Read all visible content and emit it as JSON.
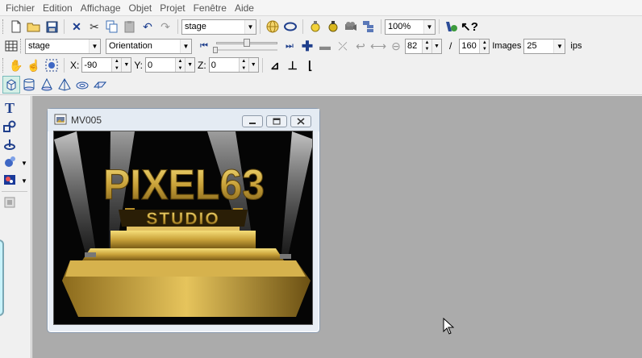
{
  "menu": {
    "items": [
      "Fichier",
      "Edition",
      "Affichage",
      "Objet",
      "Projet",
      "Fenêtre",
      "Aide"
    ]
  },
  "toolbar1": {
    "object_combo": "stage",
    "zoom_combo": "100%"
  },
  "toolbar2": {
    "object_combo": "stage",
    "property_combo": "Orientation",
    "frame_current": "82",
    "frame_separator": "/",
    "frame_total": "160",
    "images_label": "Images",
    "fps_value": "25",
    "fps_unit": "ips"
  },
  "toolbar3": {
    "x_label": "X:",
    "x_value": "-90",
    "y_label": "Y:",
    "y_value": "0",
    "z_label": "Z:",
    "z_value": "0"
  },
  "document_window": {
    "title": "MV005"
  },
  "scene": {
    "logo_line1": "PIXEL63",
    "logo_line2": "STUDIO"
  }
}
